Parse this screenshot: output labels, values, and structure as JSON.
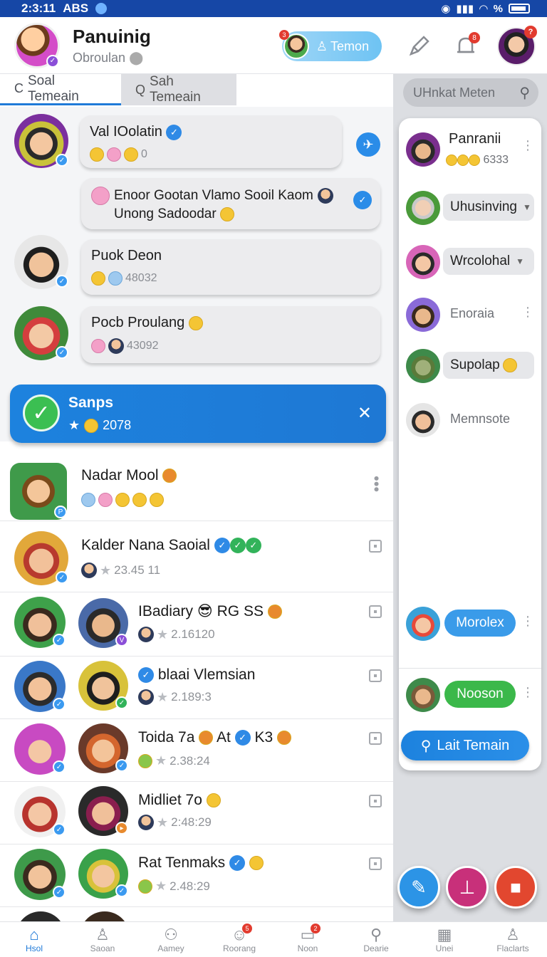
{
  "status_bar": {
    "time": "2:3:11",
    "carrier": "ABS",
    "right_text": "%"
  },
  "header": {
    "title": "Panuinig",
    "subtitle": "Obroulan",
    "pill_button_label": "Temon",
    "pill_badge": "3",
    "bell_badge": "8",
    "profile_badge": "?"
  },
  "tabs": [
    {
      "label": "Soal Temeain",
      "icon": "refresh-icon"
    },
    {
      "label": "Sah Temeain",
      "icon": "search-icon"
    }
  ],
  "chats": [
    {
      "name": "Val IOolatin",
      "meta": "0",
      "verified": true
    },
    {
      "line1": "Enoor Gootan Vlamo Sooil Kaom",
      "line2": "Unong Sadoodar"
    },
    {
      "name": "Puok Deon",
      "meta": "48032"
    },
    {
      "name": "Pocb Proulang",
      "meta": "43092"
    }
  ],
  "banner": {
    "title": "Sanps",
    "meta": "2078"
  },
  "list": [
    {
      "name": "Nadar Mool",
      "meta": ""
    },
    {
      "name": "Kalder Nana Saoial",
      "meta": "23.45 11"
    },
    {
      "name": "IBadiary",
      "name_suffix": "RG SS",
      "meta": "2.16120"
    },
    {
      "name": "blaai Vlemsian",
      "meta": "2.189:3"
    },
    {
      "name": "Toida 7a",
      "name_suffix": "At",
      "name_suffix2": "K3",
      "meta": "2.38:24"
    },
    {
      "name": "Midliet 7o",
      "meta": "2:48:29"
    },
    {
      "name": "Rat Tenmaks",
      "meta": "2.48:29"
    }
  ],
  "right_panel": {
    "search_placeholder": "UHnkat Meten",
    "people": [
      {
        "name": "Panranii",
        "meta": "6333"
      },
      {
        "name": "Uhusinving"
      },
      {
        "name": "Wrcolohal"
      },
      {
        "name": "Enoraia"
      },
      {
        "name": "Supolap"
      },
      {
        "name": "Memnsote"
      },
      {
        "name": "Morolex"
      },
      {
        "name": "Nooson"
      }
    ],
    "big_button": "Lait Temain"
  },
  "bottom_nav": [
    {
      "label": "Hsol",
      "icon": "home-icon",
      "active": true
    },
    {
      "label": "Saoan",
      "icon": "search-person-icon"
    },
    {
      "label": "Aamey",
      "icon": "people-icon"
    },
    {
      "label": "Roorang",
      "icon": "emoji-icon",
      "badge": "5"
    },
    {
      "label": "Noon",
      "icon": "card-icon",
      "badge": "2"
    },
    {
      "label": "Dearie",
      "icon": "search-icon"
    },
    {
      "label": "Unei",
      "icon": "grid-icon"
    },
    {
      "label": "Flaclarts",
      "icon": "user-icon"
    }
  ],
  "colors": {
    "accent": "#1f7ad8",
    "banner": "#1d82de",
    "green": "#3bb84a",
    "header_bar": "#1647a6"
  }
}
